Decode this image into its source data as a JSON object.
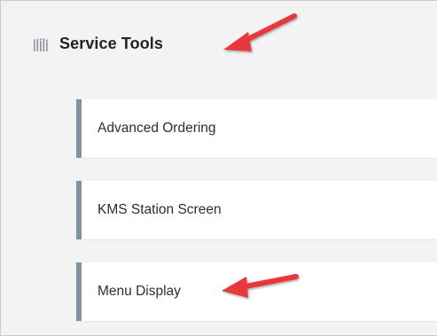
{
  "section": {
    "title": "Service Tools",
    "icon": "service-tools-icon"
  },
  "tools": [
    {
      "label": "Advanced Ordering"
    },
    {
      "label": "KMS Station Screen"
    },
    {
      "label": "Menu Display"
    }
  ],
  "colors": {
    "accent_bar": "#7f939c",
    "annotation_arrow": "#e8383d",
    "panel_background": "#f3f3f4"
  }
}
